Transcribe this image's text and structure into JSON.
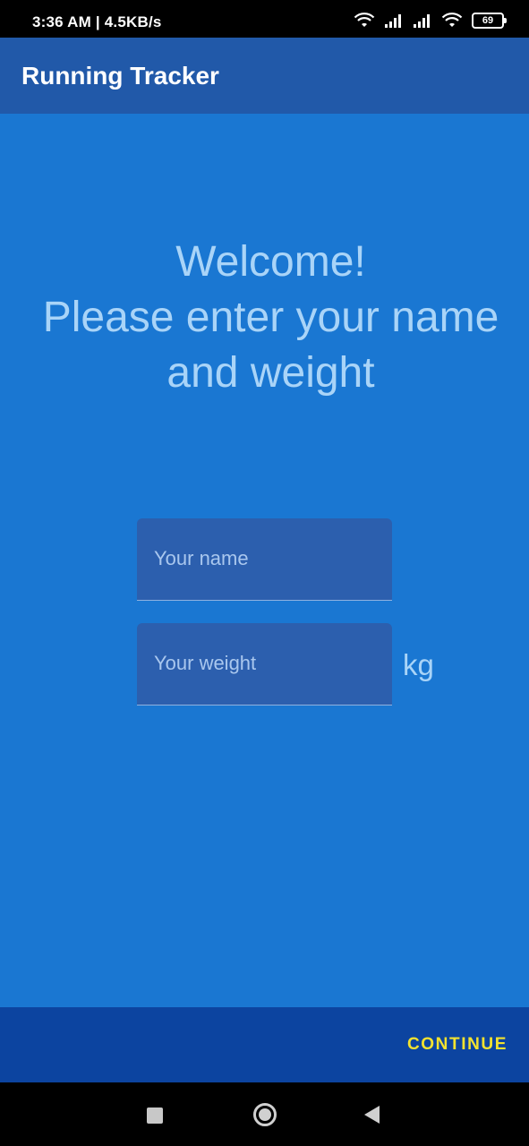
{
  "status_bar": {
    "time_speed": "3:36 AM | 4.5KB/s",
    "battery_level": "69",
    "icons": [
      "wifi-icon",
      "signal-icon",
      "signal-icon",
      "wifi-icon",
      "battery-icon"
    ]
  },
  "app_bar": {
    "title": "Running Tracker",
    "color": "#2159a9"
  },
  "welcome": {
    "line1": "Welcome!",
    "line2": "Please enter your name",
    "line3": "and weight"
  },
  "form": {
    "name_placeholder": "Your name",
    "name_value": "",
    "weight_placeholder": "Your weight",
    "weight_value": "",
    "weight_unit": "kg"
  },
  "footer": {
    "continue_label": "CONTINUE",
    "continue_color": "#f2e22f"
  },
  "nav_bar": {
    "icons": [
      "recent-apps-icon",
      "home-icon",
      "back-icon"
    ]
  },
  "colors": {
    "background": "#1a77d2",
    "footer": "#0c44a0"
  }
}
